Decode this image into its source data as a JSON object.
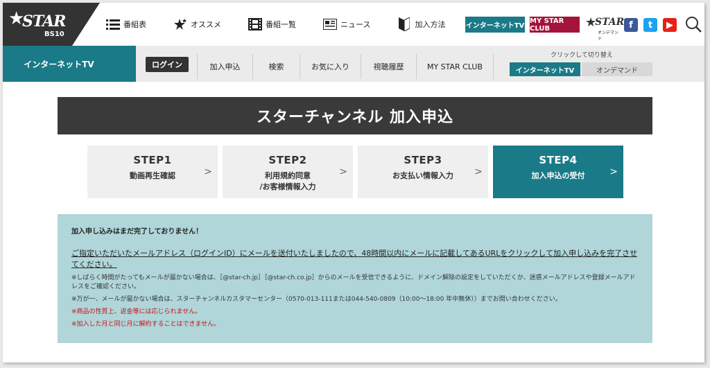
{
  "header": {
    "logo": {
      "text": "STAR",
      "sub": "BS10"
    },
    "nav": [
      {
        "label": "番組表",
        "icon": "list-icon"
      },
      {
        "label": "オススメ",
        "icon": "star-icon"
      },
      {
        "label": "番組一覧",
        "icon": "film-icon"
      },
      {
        "label": "ニュース",
        "icon": "news-icon"
      },
      {
        "label": "加入方法",
        "icon": "beginner-mark-icon"
      }
    ],
    "internet_tv_button": "インターネットTV",
    "my_star_club_button": "MY STAR CLUB",
    "ondemand_logo": {
      "text": "STAR",
      "sub": "オンデマンド"
    },
    "social": {
      "facebook": "f",
      "twitter": "t",
      "youtube": "▶"
    }
  },
  "subnav": {
    "section": "インターネットTV",
    "login": "ログイン",
    "items": [
      "加入申込",
      "検索",
      "お気に入り",
      "視聴履歴",
      "MY STAR CLUB"
    ],
    "toggle_label": "クリックして切り替え",
    "toggle_internet_tv": "インターネットTV",
    "toggle_ondemand": "オンデマンド"
  },
  "page_title": "スターチャンネル 加入申込",
  "steps": [
    {
      "step": "STEP1",
      "desc": "動画再生確認",
      "active": false
    },
    {
      "step": "STEP2",
      "desc": "利用規約同意\n/お客様情報入力",
      "active": false
    },
    {
      "step": "STEP3",
      "desc": "お支払い情報入力",
      "active": false
    },
    {
      "step": "STEP4",
      "desc": "加入申込の受付",
      "active": true
    }
  ],
  "notice": {
    "heading": "加入申し込みはまだ完了しておりません！",
    "main": "ご指定いただいたメールアドレス（ログインID）にメールを送付いたしましたので、48時間以内にメールに記載してあるURLをクリックして加入申し込みを完了させてください。",
    "note1": "※しばらく時間がたってもメールが届かない場合は、［@star-ch.jp］［@star-ch.co.jp］からのメールを受信できるように、ドメイン解除の設定をしていただくか、迷惑メールアドレスや登録メールアドレスをご確認ください。",
    "note2": "※万が一、メールが届かない場合は、スターチャンネルカスタマーセンター（0570-013-111または044-540-0809（10:00〜18:00 年中無休））までお問い合わせください。",
    "note3": "※商品の性質上、返金等には応じられません。",
    "note4": "※加入した月と同じ月に解約することはできません。"
  },
  "colors": {
    "teal": "#1b7a87",
    "crimson": "#a3133a",
    "dark": "#3a3a3a",
    "notice_bg": "#b0d6d9",
    "warning": "#c0141a"
  }
}
